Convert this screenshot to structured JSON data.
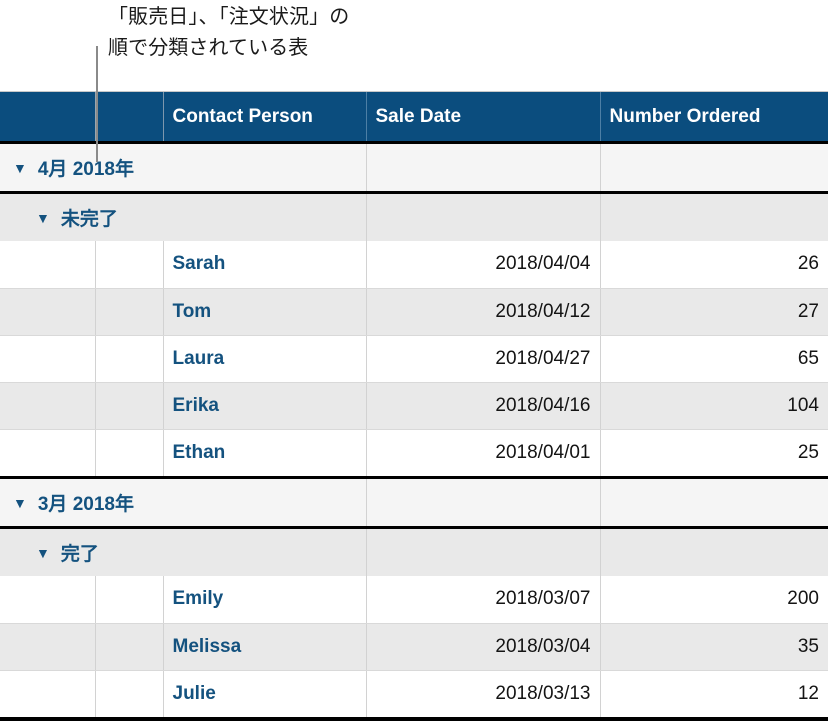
{
  "callout": {
    "text": "「販売日」、「注文状況」の\n順で分類されている表",
    "leader_line": "vertical-leader-line"
  },
  "table": {
    "columns": [
      {
        "key": "handle",
        "label": ""
      },
      {
        "key": "spacer",
        "label": ""
      },
      {
        "key": "name",
        "label": "Contact Person"
      },
      {
        "key": "date",
        "label": "Sale Date"
      },
      {
        "key": "num",
        "label": "Number Ordered"
      }
    ],
    "disclosure_glyph": "▼",
    "groups": [
      {
        "level1_label": "4月 2018年",
        "subgroups": [
          {
            "level2_label": "未完了",
            "rows": [
              {
                "name": "Sarah",
                "date": "2018/04/04",
                "num": "26"
              },
              {
                "name": "Tom",
                "date": "2018/04/12",
                "num": "27"
              },
              {
                "name": "Laura",
                "date": "2018/04/27",
                "num": "65"
              },
              {
                "name": "Erika",
                "date": "2018/04/16",
                "num": "104"
              },
              {
                "name": "Ethan",
                "date": "2018/04/01",
                "num": "25"
              }
            ]
          }
        ]
      },
      {
        "level1_label": "3月 2018年",
        "subgroups": [
          {
            "level2_label": "完了",
            "rows": [
              {
                "name": "Emily",
                "date": "2018/03/07",
                "num": "200"
              },
              {
                "name": "Melissa",
                "date": "2018/03/04",
                "num": "35"
              },
              {
                "name": "Julie",
                "date": "2018/03/13",
                "num": "12"
              }
            ]
          }
        ]
      }
    ]
  },
  "colors": {
    "header_blue": "#0b4d7e",
    "accent_text_blue": "#14527f",
    "stripe_gray": "#e9e9e9",
    "group_lvl1_gray": "#f5f5f5",
    "rule_black": "#000000",
    "leader_gray": "#8a8a8a"
  }
}
